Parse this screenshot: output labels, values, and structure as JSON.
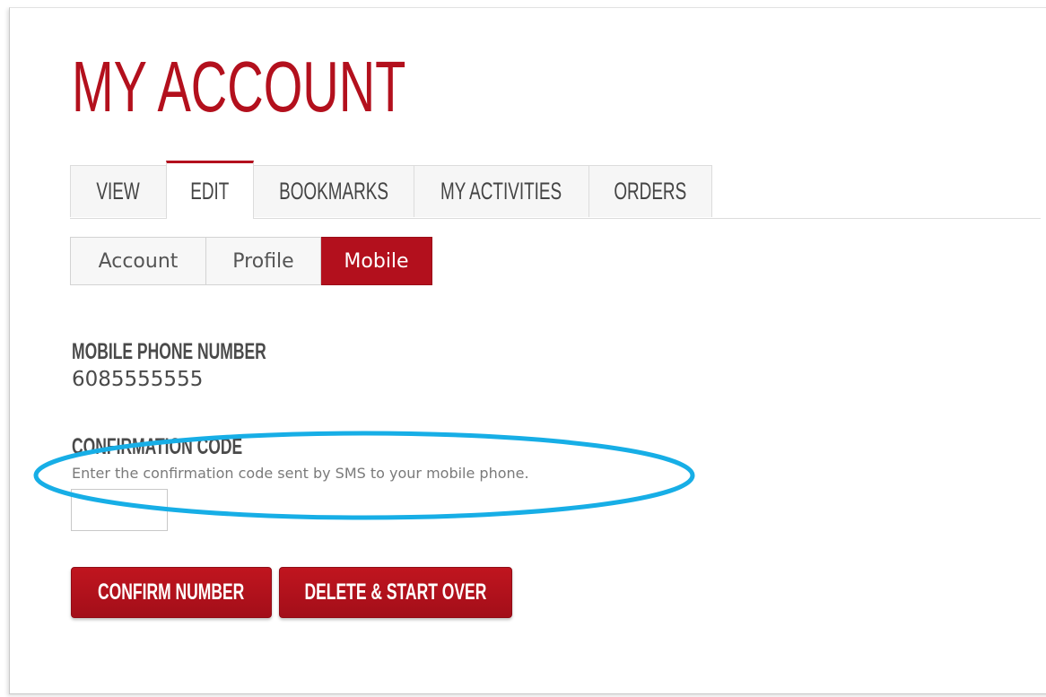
{
  "page": {
    "title": "MY ACCOUNT"
  },
  "primary_tabs": [
    {
      "label": "VIEW"
    },
    {
      "label": "EDIT",
      "active": true
    },
    {
      "label": "BOOKMARKS"
    },
    {
      "label": "MY ACTIVITIES"
    },
    {
      "label": "ORDERS"
    }
  ],
  "secondary_tabs": [
    {
      "label": "Account"
    },
    {
      "label": "Profile"
    },
    {
      "label": "Mobile",
      "active": true
    }
  ],
  "mobile": {
    "phone_label": "MOBILE PHONE NUMBER",
    "phone_value": "6085555555",
    "code_label": "CONFIRMATION CODE",
    "code_description": "Enter the confirmation code sent by SMS to your mobile phone.",
    "code_value": ""
  },
  "buttons": {
    "confirm_label": "CONFIRM NUMBER",
    "delete_label": "DELETE & START OVER"
  },
  "colors": {
    "accent": "#b3101d",
    "highlight": "#17aee6"
  }
}
